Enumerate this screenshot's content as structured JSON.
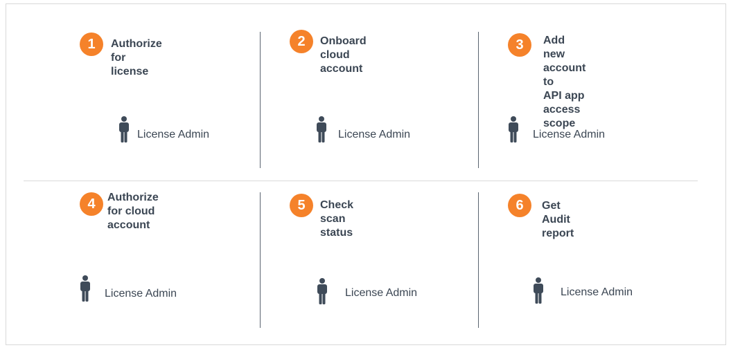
{
  "steps": [
    {
      "number": "1",
      "title": "Authorize for license",
      "role": "License Admin"
    },
    {
      "number": "2",
      "title": "Onboard cloud account",
      "role": "License Admin"
    },
    {
      "number": "3",
      "title": "Add new account to\nAPI app access scope",
      "role": "License Admin"
    },
    {
      "number": "4",
      "title": "Authorize for cloud\naccount",
      "role": "License Admin"
    },
    {
      "number": "5",
      "title": "Check scan status",
      "role": "License Admin"
    },
    {
      "number": "6",
      "title": "Get Audit report",
      "role": "License Admin"
    }
  ],
  "colors": {
    "badge": "#f5822a",
    "text": "#3b4653",
    "icon": "#3f4b59"
  },
  "icons": {
    "role": "person-icon"
  }
}
